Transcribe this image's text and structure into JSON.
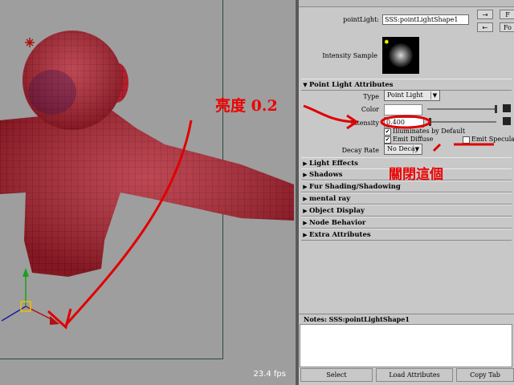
{
  "viewport": {
    "fps": "23.4 fps"
  },
  "attribute_editor": {
    "pointlight_label": "pointLight:",
    "pointlight_value": "SSS:pointLightShape1",
    "intensity_sample_label": "Intensity Sample",
    "sections": [
      {
        "label": "Point Light Attributes",
        "expanded": true
      },
      {
        "label": "Light Effects",
        "expanded": false
      },
      {
        "label": "Shadows",
        "expanded": false
      },
      {
        "label": "Fur Shading/Shadowing",
        "expanded": false
      },
      {
        "label": "mental ray",
        "expanded": false
      },
      {
        "label": "Object Display",
        "expanded": false
      },
      {
        "label": "Node Behavior",
        "expanded": false
      },
      {
        "label": "Extra Attributes",
        "expanded": false
      }
    ],
    "type_label": "Type",
    "type_value": "Point Light",
    "color_label": "Color",
    "intensity_label": "Intensity",
    "intensity_value": "0.400",
    "illuminates_label": "Illuminates by Default",
    "emit_diffuse_label": "Emit Diffuse",
    "emit_specular_label": "Emit Specular",
    "decay_label": "Decay Rate",
    "decay_value": "No Decay",
    "top_buttons": [
      "F",
      "Fo"
    ],
    "notes_label": "Notes:  SSS:pointLightShape1",
    "bottom_buttons": [
      "Select",
      "Load Attributes",
      "Copy Tab"
    ]
  },
  "annotations": {
    "brightness": "亮度 0.2",
    "close_this": "關閉這個"
  },
  "colors": {
    "viewport_bg": "#9e9e9e",
    "model_red": "#b0202e",
    "annotation_red": "#e00000",
    "panel_bg": "#c8c8c8"
  }
}
